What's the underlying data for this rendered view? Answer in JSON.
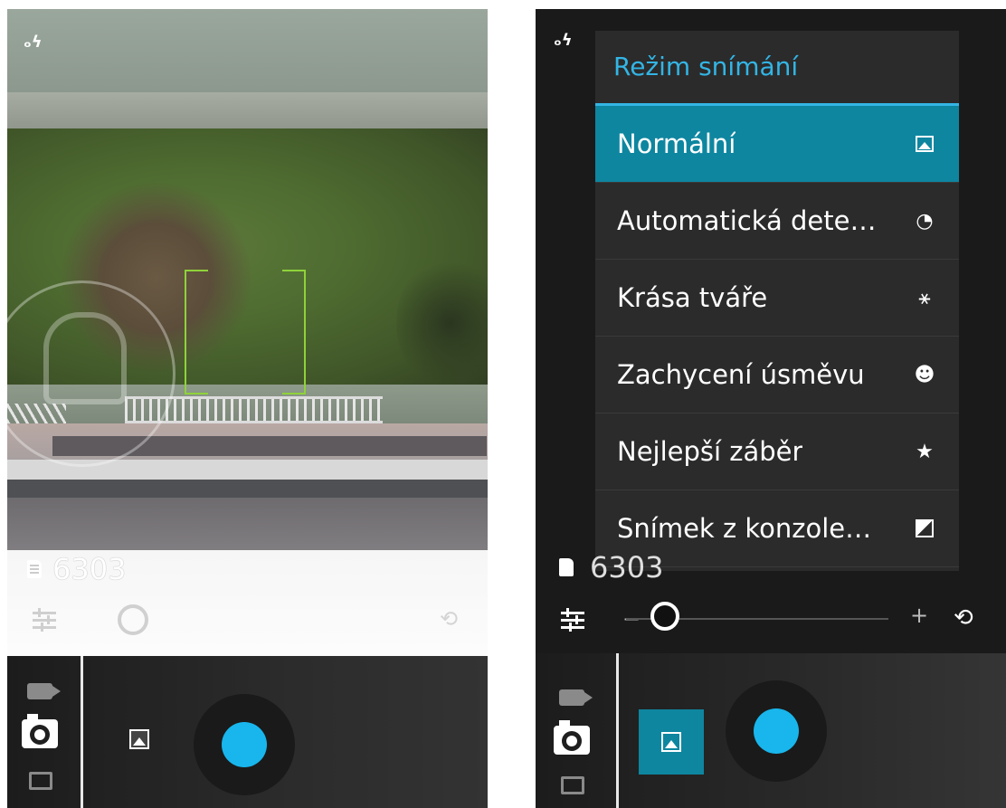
{
  "left_screen": {
    "flash_icon": "flash-auto-icon",
    "photo_counter": "6303",
    "icons": {
      "settings": "sliders-icon",
      "mode_ring": "ring-icon",
      "switch_camera": "switch-camera-icon",
      "video": "video-icon",
      "camera": "camera-icon",
      "panorama": "panorama-icon",
      "scene": "picture-icon",
      "shutter": "shutter-button"
    }
  },
  "right_screen": {
    "flash_icon": "flash-auto-icon",
    "menu": {
      "title": "Režim snímání",
      "items": [
        {
          "label": "Normální",
          "icon": "picture-icon",
          "selected": true
        },
        {
          "label": "Automatická dete…",
          "icon": "speedometer-icon",
          "selected": false
        },
        {
          "label": "Krása tváře",
          "icon": "magic-wand-icon",
          "selected": false
        },
        {
          "label": "Zachycení úsměvu",
          "icon": "smiley-icon",
          "selected": false
        },
        {
          "label": "Nejlepší záběr",
          "icon": "star-icon",
          "selected": false
        },
        {
          "label": "Snímek z konzole…",
          "icon": "exposure-icon",
          "selected": false
        }
      ]
    },
    "photo_counter": "6303",
    "zoom": {
      "minus": "−",
      "plus": "+",
      "level": 0.1
    }
  },
  "colors": {
    "accent": "#33b5e5",
    "selected_bg": "#0e86a0",
    "shutter": "#18b6ec",
    "focus_frame": "#8fd23a"
  }
}
